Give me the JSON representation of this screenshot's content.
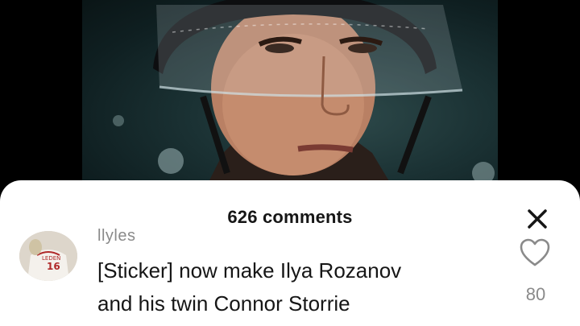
{
  "comments_header": {
    "count_label": "626 comments"
  },
  "comment": {
    "username": "llyles",
    "text_line1": "[Sticker] now make Ilya Rozanov",
    "text_line2": "and his twin Connor Storrie",
    "likes": "80"
  },
  "icons": {
    "close": "close-icon",
    "like": "heart-icon",
    "avatar": "user-avatar"
  },
  "colors": {
    "sheet": "#ffffff",
    "text": "#161616",
    "muted": "#8a8a8a",
    "video_bg": "#000000"
  }
}
